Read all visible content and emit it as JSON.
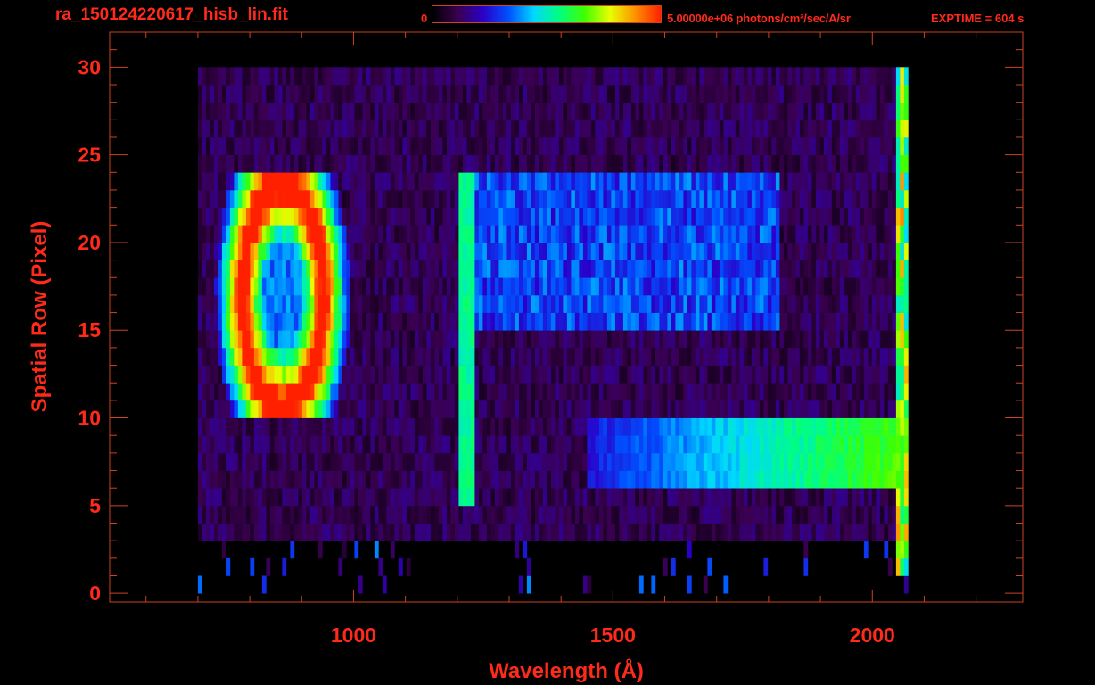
{
  "header": {
    "filename": "ra_150124220617_hisb_lin.fit",
    "colorbar_min": "0",
    "colorbar_max": "5.00000e+06 photons/cm²/sec/A/sr",
    "exptime": "EXPTIME = 604 s"
  },
  "colorbar_colors": [
    "#000000",
    "#3a0050",
    "#2a00c8",
    "#0050ff",
    "#00d8ff",
    "#00ff80",
    "#40ff00",
    "#e8ff00",
    "#ff9000",
    "#ff2000"
  ],
  "chart_data": {
    "type": "heatmap",
    "xlabel": "Wavelength (Å)",
    "ylabel": "Spatial Row (Pixel)",
    "xlim": [
      530,
      2290
    ],
    "ylim": [
      -0.5,
      32
    ],
    "xticks": [
      1000,
      1500,
      2000
    ],
    "xtick_labels": [
      "1000",
      "1500",
      "2000"
    ],
    "yticks": [
      0,
      5,
      10,
      15,
      20,
      25,
      30
    ],
    "ytick_labels": [
      "0",
      "5",
      "10",
      "15",
      "20",
      "25",
      "30"
    ],
    "data_extent": {
      "x": [
        700,
        2070
      ],
      "y": [
        0,
        30
      ]
    },
    "colorbar": {
      "min": 0,
      "max": 5000000,
      "units": "photons/cm²/sec/A/sr"
    },
    "features": [
      {
        "kind": "emission-line",
        "x": 1216,
        "rows": [
          5,
          24
        ],
        "level": 0.5
      },
      {
        "kind": "ring-source",
        "x_center": 860,
        "rows": [
          10,
          24
        ],
        "level": 0.9
      },
      {
        "kind": "continuum-band",
        "x": [
          1500,
          2060
        ],
        "rows": [
          5.5,
          10
        ],
        "level": 0.6
      },
      {
        "kind": "diffuse-band",
        "x": [
          1220,
          1820
        ],
        "rows": [
          15,
          24
        ],
        "level": 0.35
      }
    ]
  }
}
